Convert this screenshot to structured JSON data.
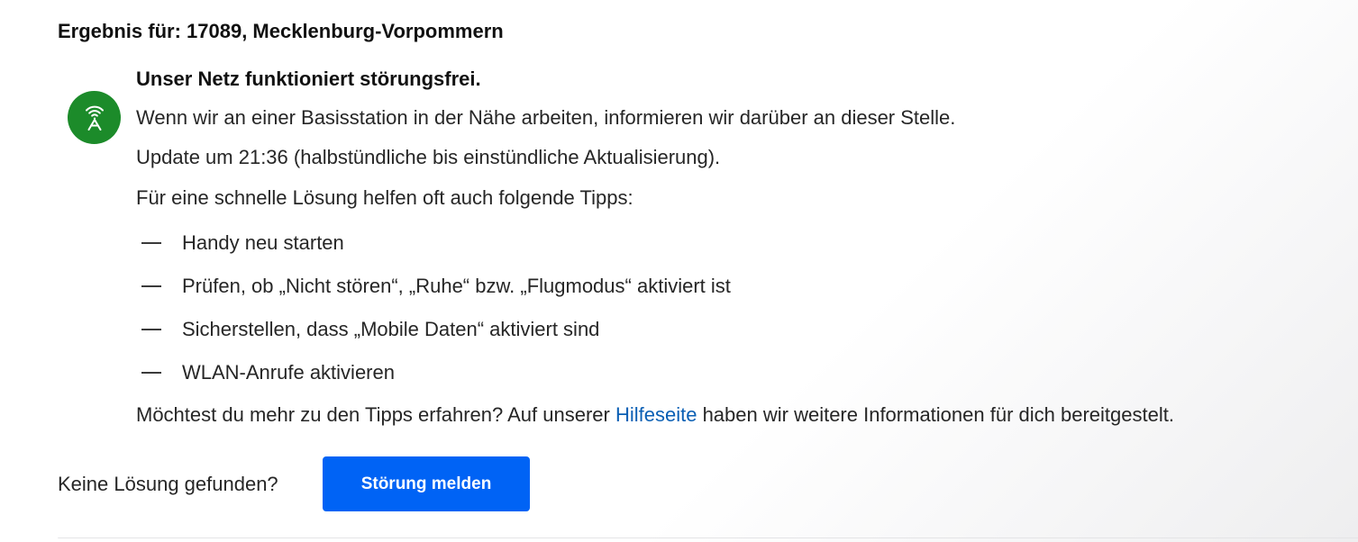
{
  "result": {
    "heading": "Ergebnis für: 17089, Mecklenburg-Vorpommern"
  },
  "status": {
    "icon": "antenna-tower-icon",
    "icon_color": "#1c8b2a",
    "title": "Unser Netz funktioniert störungsfrei.",
    "description": "Wenn wir an einer Basisstation in der Nähe arbeiten, informieren wir darüber an dieser Stelle.",
    "update": "Update um 21:36 (halbstündliche bis einstündliche Aktualisierung).",
    "tips_intro": "Für eine schnelle Lösung helfen oft auch folgende Tipps:",
    "tips": [
      "Handy neu starten",
      "Prüfen, ob „Nicht stören“, „Ruhe“ bzw. „Flugmodus“ aktiviert ist",
      "Sicherstellen, dass „Mobile Daten“ aktiviert sind",
      "WLAN-Anrufe aktivieren"
    ],
    "more_prefix": "Möchtest du mehr zu den Tipps erfahren? Auf unserer ",
    "help_link": "Hilfeseite",
    "more_suffix": " haben wir weitere Informationen für dich bereitgestelt."
  },
  "footer": {
    "no_solution": "Keine Lösung gefunden?",
    "report_button": "Störung melden",
    "button_color": "#0063f5",
    "link_color": "#0a5fb4"
  }
}
